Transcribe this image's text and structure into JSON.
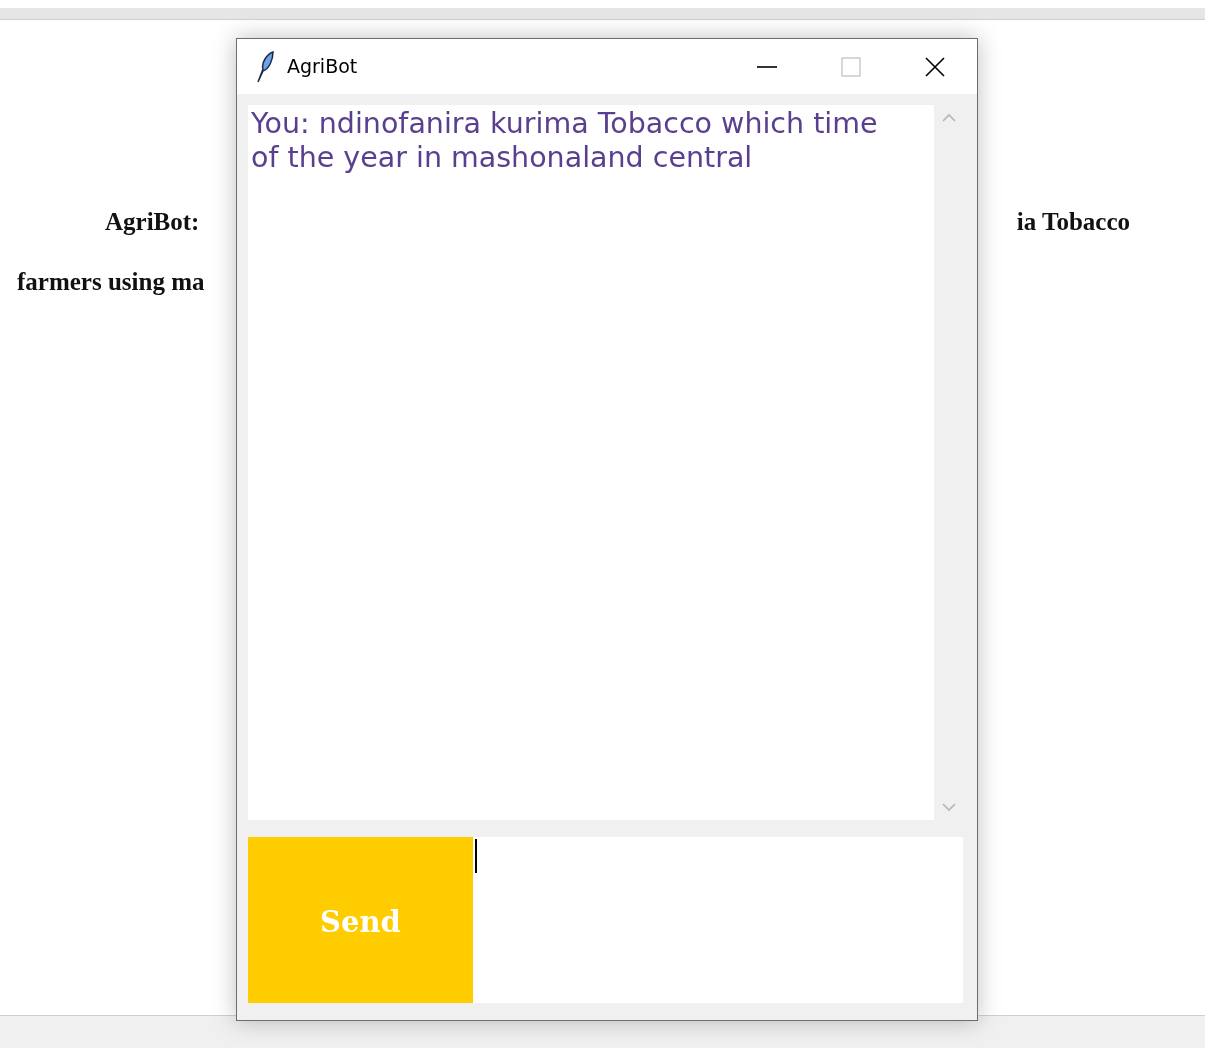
{
  "document": {
    "lines": [
      {
        "left": "AgriBot:",
        "right": "ia Tobacco"
      },
      {
        "left": "farmers using ma"
      }
    ]
  },
  "window": {
    "title": "AgriBot",
    "controls": [
      {
        "kind": "minimize",
        "disabled": false
      },
      {
        "kind": "maximize",
        "disabled": true
      },
      {
        "kind": "close",
        "disabled": false
      }
    ],
    "messages": [
      {
        "text": "You: ndinofanira kurima Tobacco which time of the year in mashonaland central"
      }
    ],
    "send_button": {
      "label": "Send"
    }
  }
}
